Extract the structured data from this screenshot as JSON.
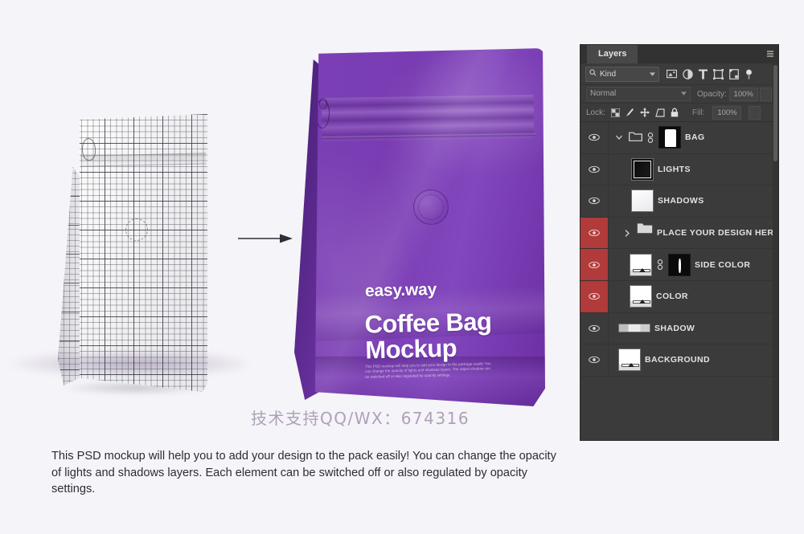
{
  "panel": {
    "tab_label": "Layers",
    "menu_icon": "panel-menu-icon",
    "filter": {
      "search_icon": "search-icon",
      "kind_label": "Kind",
      "chevron_icon": "chevron-down-icon",
      "icons": [
        "pixel-filter-icon",
        "adjustment-filter-icon",
        "type-filter-icon",
        "shape-filter-icon",
        "smart-object-filter-icon",
        "filter-toggle-icon"
      ]
    },
    "blend": {
      "mode": "Normal",
      "opacity_label": "Opacity:",
      "opacity_value": "100%",
      "chevron_icon": "chevron-down-icon"
    },
    "lock": {
      "label": "Lock:",
      "icons": [
        "lock-transparent-pixels-icon",
        "lock-image-pixels-icon",
        "lock-position-icon",
        "lock-artboard-nesting-icon",
        "lock-all-icon"
      ],
      "fill_label": "Fill:",
      "fill_value": "100%"
    },
    "layers": [
      {
        "name": "BAG",
        "visible": true,
        "selected": false,
        "type": "group",
        "expanded": true,
        "icons": [
          "eye-icon",
          "chevron-down-icon",
          "folder-icon",
          "link-icon"
        ],
        "thumb": "mask-black"
      },
      {
        "name": "LIGHTS",
        "visible": true,
        "selected": false,
        "type": "layer",
        "icons": [
          "eye-icon"
        ],
        "thumb": "lights"
      },
      {
        "name": "SHADOWS",
        "visible": true,
        "selected": false,
        "type": "layer",
        "icons": [
          "eye-icon"
        ],
        "thumb": "shadows"
      },
      {
        "name": "PLACE YOUR DESIGN HERE",
        "visible": true,
        "selected": true,
        "type": "group",
        "expanded": false,
        "icons": [
          "eye-icon",
          "chevron-right-icon",
          "folder-icon"
        ],
        "thumb": "folder"
      },
      {
        "name": "SIDE COLOR",
        "visible": true,
        "selected": true,
        "type": "fill",
        "icons": [
          "eye-icon",
          "link-icon"
        ],
        "thumb": "fill-with-mask"
      },
      {
        "name": "COLOR",
        "visible": true,
        "selected": true,
        "type": "fill",
        "icons": [
          "eye-icon"
        ],
        "thumb": "fill"
      },
      {
        "name": "SHADOW",
        "visible": true,
        "selected": false,
        "type": "layer",
        "icons": [
          "eye-icon"
        ],
        "thumb": "shadow-bar"
      },
      {
        "name": "BACKGROUND",
        "visible": true,
        "selected": false,
        "type": "fill",
        "icons": [
          "eye-icon"
        ],
        "thumb": "fill"
      }
    ]
  },
  "canvas": {
    "wireframe_bag_label": "wireframe-coffee-bag",
    "arrow_label": "transformation-arrow",
    "bag": {
      "brand": "easy.way",
      "headline": "Coffee Bag\nMockup",
      "body": "This PSD mockup will help you to add your design to the package easily! You can change the opacity of lights and shadows layers. The object shadow can be switched off or also regulated by opacity settings.",
      "colors": {
        "front": "#7b3fb5",
        "side": "#5c2a8e",
        "text": "#ffffff"
      }
    },
    "watermark": "技术支持QQ/WX：674316"
  },
  "description": "This PSD mockup will help you to add your design to the pack easily!  You can change the opacity of lights and shadows layers. Each element can be switched off or also regulated by opacity settings."
}
